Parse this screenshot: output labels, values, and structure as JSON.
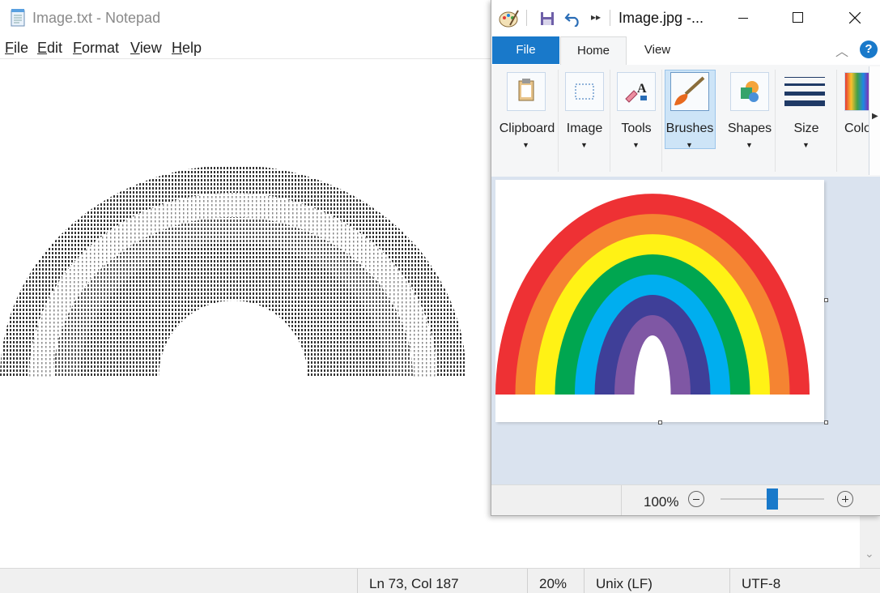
{
  "notepad": {
    "title": "Image.txt - Notepad",
    "menu": [
      {
        "key": "F",
        "rest": "ile"
      },
      {
        "key": "E",
        "rest": "dit"
      },
      {
        "key": "F",
        "rest": "ormat"
      },
      {
        "key": "V",
        "rest": "iew"
      },
      {
        "key": "H",
        "rest": "elp"
      }
    ],
    "status": {
      "position": "Ln 73, Col 187",
      "zoom": "20%",
      "line_ending": "Unix (LF)",
      "encoding": "UTF-8"
    }
  },
  "paint": {
    "title": "Image.jpg -...",
    "tabs": {
      "file": "File",
      "home": "Home",
      "view": "View"
    },
    "help": "?",
    "ribbon": {
      "clipboard": "Clipboard",
      "image": "Image",
      "tools": "Tools",
      "brushes": "Brushes",
      "shapes": "Shapes",
      "size": "Size",
      "colors": "Colo"
    },
    "zoom_label": "100%",
    "zoom_level": 0.5,
    "rainbow_colors": [
      "#ee3134",
      "#f58432",
      "#fff215",
      "#00a650",
      "#00aeef",
      "#3f3f98",
      "#7f57a4"
    ]
  }
}
